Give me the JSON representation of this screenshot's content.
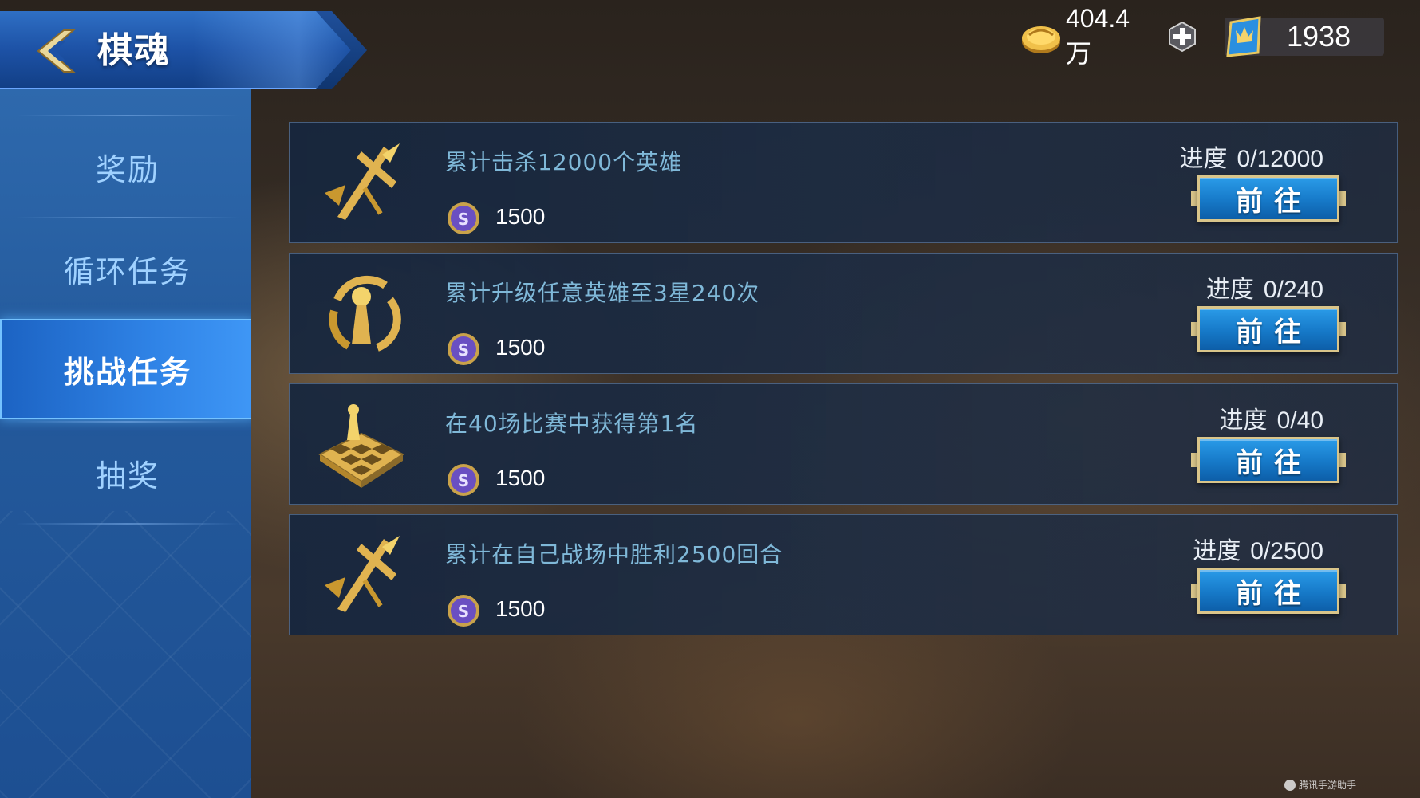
{
  "header": {
    "title": "棋魂",
    "back_icon": "back-chevron-icon"
  },
  "currency": {
    "gold": "404.4万",
    "tickets": "1938"
  },
  "sidebar": {
    "items": [
      {
        "label": "奖励",
        "active": false
      },
      {
        "label": "循环任务",
        "active": false
      },
      {
        "label": "挑战任务",
        "active": true
      },
      {
        "label": "抽奖",
        "active": false
      }
    ]
  },
  "tasks": [
    {
      "icon": "sword-icon",
      "description": "累计击杀12000个英雄",
      "reward": "1500",
      "progress_label": "进度",
      "progress": "0/12000",
      "button": "前往"
    },
    {
      "icon": "chess-piece-upgrade-icon",
      "description": "累计升级任意英雄至3星240次",
      "reward": "1500",
      "progress_label": "进度",
      "progress": "0/240",
      "button": "前往"
    },
    {
      "icon": "chessboard-icon",
      "description": "在40场比赛中获得第1名",
      "reward": "1500",
      "progress_label": "进度",
      "progress": "0/40",
      "button": "前往"
    },
    {
      "icon": "sword-icon",
      "description": "累计在自己战场中胜利2500回合",
      "reward": "1500",
      "progress_label": "进度",
      "progress": "0/2500",
      "button": "前往"
    }
  ],
  "watermark": "腾讯手游助手",
  "colors": {
    "accent_blue": "#1c63c3",
    "task_text": "#7fb8d8",
    "gold": "#e0b350",
    "button_border": "#d9c58a"
  }
}
